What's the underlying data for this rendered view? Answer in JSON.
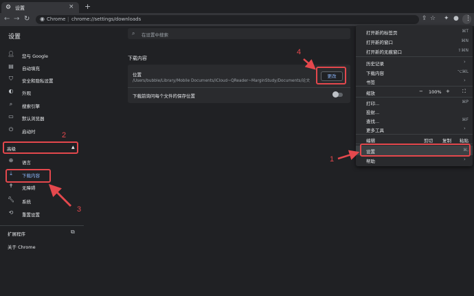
{
  "browser": {
    "tab_title": "设置",
    "tab_close": "×",
    "new_tab": "+",
    "url_scheme_label": "Chrome",
    "url_separator": "|",
    "url": "chrome://settings/downloads",
    "icons": [
      "back-icon",
      "forward-icon",
      "reload-icon",
      "share-icon",
      "star-icon",
      "extensions-icon",
      "profile-icon",
      "more-icon"
    ]
  },
  "settings": {
    "title": "设置",
    "search_placeholder": "在设置中搜索",
    "sidebar": {
      "items": [
        {
          "label": "您与 Google",
          "icon": "person-icon"
        },
        {
          "label": "自动填充",
          "icon": "clipboard-icon"
        },
        {
          "label": "安全和隐私设置",
          "icon": "shield-icon"
        },
        {
          "label": "外观",
          "icon": "palette-icon"
        },
        {
          "label": "搜索引擎",
          "icon": "search-icon"
        },
        {
          "label": "默认浏览器",
          "icon": "browser-icon"
        },
        {
          "label": "启动时",
          "icon": "power-icon"
        }
      ],
      "advanced_label": "高级",
      "advanced_caret": "▲",
      "advanced_items": [
        {
          "label": "语言",
          "icon": "globe-icon"
        },
        {
          "label": "下载内容",
          "icon": "download-icon",
          "active": true
        },
        {
          "label": "无障碍",
          "icon": "accessibility-icon"
        },
        {
          "label": "系统",
          "icon": "wrench-icon"
        },
        {
          "label": "重置设置",
          "icon": "restore-icon"
        }
      ],
      "extensions_label": "扩展程序",
      "about_label": "关于 Chrome"
    },
    "downloads": {
      "section_title": "下载内容",
      "location_label": "位置",
      "location_path": "/Users/bubble/Library/Mobile Documents/iCloud~QReader~MarginStudy/Documents/论文",
      "change_button": "更改",
      "ask_label": "下载前询问每个文件的保存位置",
      "ask_enabled": false
    }
  },
  "menu": {
    "items": [
      {
        "label": "打开新的标签页",
        "shortcut": "⌘T"
      },
      {
        "label": "打开新的窗口",
        "shortcut": "⌘N"
      },
      {
        "label": "打开新的无痕窗口",
        "shortcut": "⇧⌘N"
      },
      {
        "label": "历史记录",
        "arrow": "›"
      },
      {
        "label": "下载内容",
        "shortcut": "⌥⌘L"
      },
      {
        "label": "书签",
        "arrow": "›"
      }
    ],
    "zoom": {
      "label": "缩放",
      "minus": "−",
      "value": "100%",
      "plus": "+",
      "fullscreen": "⛶"
    },
    "items2": [
      {
        "label": "打印...",
        "shortcut": "⌘P"
      },
      {
        "label": "投射..."
      },
      {
        "label": "查找...",
        "shortcut": "⌘F"
      },
      {
        "label": "更多工具",
        "arrow": "›"
      }
    ],
    "edit": {
      "label": "编辑",
      "cut": "剪切",
      "copy": "复制",
      "paste": "粘贴"
    },
    "settings": {
      "label": "设置",
      "shortcut": "⌘,"
    },
    "help": {
      "label": "帮助",
      "arrow": "›"
    }
  },
  "annotations": {
    "numbers": [
      "1",
      "2",
      "3",
      "4"
    ],
    "color": "#e5484d"
  },
  "colors": {
    "accent": "#8ab4f8",
    "background": "#202124",
    "card": "#2a2b2e",
    "annotation_red": "#e5484d"
  }
}
